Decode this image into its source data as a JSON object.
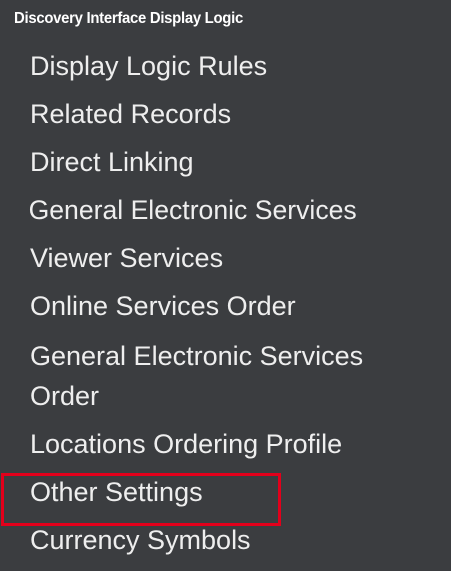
{
  "panel": {
    "header": "Discovery Interface Display Logic",
    "highlight_color": "#e3001b",
    "items": [
      {
        "label": "Display Logic Rules"
      },
      {
        "label": "Related Records"
      },
      {
        "label": "Direct Linking"
      },
      {
        "label": "General Electronic Services"
      },
      {
        "label": "Viewer Services"
      },
      {
        "label": "Online Services Order"
      },
      {
        "label": "General Electronic Services Order"
      },
      {
        "label": "Locations Ordering Profile"
      },
      {
        "label": "Other Settings",
        "highlighted": true
      },
      {
        "label": "Currency Symbols"
      }
    ]
  }
}
